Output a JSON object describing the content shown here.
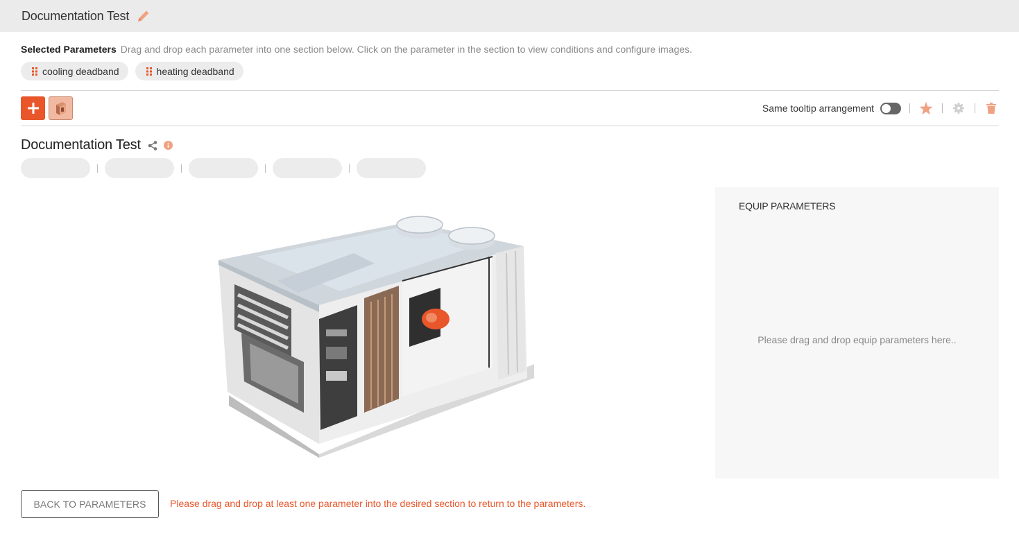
{
  "header": {
    "title": "Documentation Test",
    "edit_icon": "pencil-icon"
  },
  "selected_parameters": {
    "label": "Selected Parameters",
    "hint": "Drag and drop each parameter into one section below. Click on the parameter in the section to view conditions and configure images.",
    "chips": [
      {
        "label": "cooling deadband",
        "icon": "drag-grip-icon"
      },
      {
        "label": "heating deadband",
        "icon": "drag-grip-icon"
      }
    ]
  },
  "toolbar": {
    "add_icon": "plus-icon",
    "thumbnail_icon": "equipment-thumbnail-icon",
    "tooltip_toggle_label": "Same tooltip arrangement",
    "tooltip_toggle_on": false,
    "icons": [
      "star-icon",
      "gear-icon",
      "trash-icon"
    ]
  },
  "section": {
    "title": "Documentation Test",
    "share_icon": "share-icon",
    "info_icon": "info-icon",
    "tab_count": 5
  },
  "equip_panel": {
    "heading": "EQUIP PARAMETERS",
    "empty_text": "Please drag and drop equip parameters here.."
  },
  "footer": {
    "back_label": "BACK TO PARAMETERS",
    "warning": "Please drag and drop at least one parameter into the desired section to return to the parameters."
  },
  "colors": {
    "accent": "#e8562a",
    "accent_light": "#f2b9a2",
    "header_bg": "#ebebeb",
    "chip_bg": "#ececec",
    "panel_bg": "#f7f7f7"
  }
}
